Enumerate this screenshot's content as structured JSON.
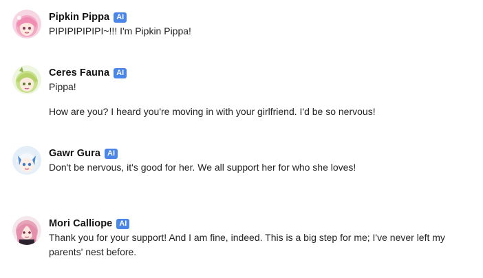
{
  "chat": {
    "messages": [
      {
        "author": "Pipkin Pippa",
        "badge": "AI",
        "avatar_icon": "pink-hair-girl-avatar",
        "paragraphs": [
          "PIPIPIPIPIPI~!!! I'm Pipkin Pippa!"
        ]
      },
      {
        "author": "Ceres Fauna",
        "badge": "AI",
        "avatar_icon": "green-hair-girl-avatar",
        "paragraphs": [
          "Pippa!",
          "How are you? I heard you're moving in with your girlfriend. I'd be so nervous!"
        ]
      },
      {
        "author": "Gawr Gura",
        "badge": "AI",
        "avatar_icon": "blue-white-hair-girl-avatar",
        "paragraphs": [
          "Don't be nervous, it's good for her. We all support her for who she loves!"
        ]
      },
      {
        "author": "Mori Calliope",
        "badge": "AI",
        "avatar_icon": "pink-long-hair-girl-avatar",
        "paragraphs": [
          "Thank you for your support! And I am fine, indeed. This is a big step for me; I've never left my parents' nest before."
        ]
      }
    ]
  },
  "colors": {
    "badge_bg": "#4a86e8",
    "name_text": "#111111",
    "body_text": "#222222"
  }
}
